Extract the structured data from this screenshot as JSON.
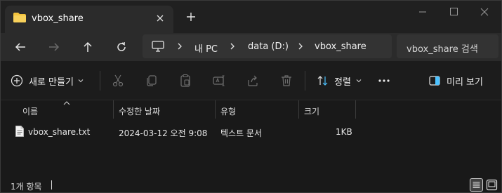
{
  "tab": {
    "title": "vbox_share",
    "icon": "folder-icon"
  },
  "window_controls": [
    "minimize-icon",
    "maximize-icon",
    "close-icon"
  ],
  "address_bar": {
    "crumbs": [
      "내 PC",
      "data (D:)",
      "vbox_share"
    ]
  },
  "search": {
    "placeholder": "vbox_share 검색"
  },
  "command_bar": {
    "new_label": "새로 만들기",
    "sort_label": "정렬",
    "preview_label": "미리 보기",
    "icons": [
      "cut-icon",
      "copy-icon",
      "paste-icon",
      "rename-icon",
      "share-icon",
      "delete-icon"
    ]
  },
  "columns": {
    "name": "이름",
    "modified": "수정한 날짜",
    "type": "유형",
    "size": "크기"
  },
  "files": [
    {
      "name": "vbox_share.txt",
      "modified": "2024-03-12 오전 9:08",
      "type": "텍스트 문서",
      "size": "1KB"
    }
  ],
  "status": {
    "item_count": "1개 항목"
  },
  "colors": {
    "background": "#191919",
    "folder_accent": "#f3c23c"
  }
}
